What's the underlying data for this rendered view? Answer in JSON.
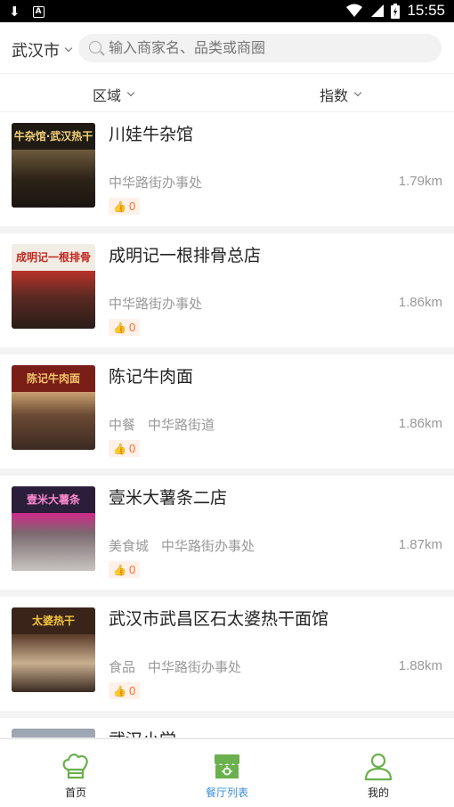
{
  "status_bar": {
    "time": "15:55",
    "icons": [
      "download-icon",
      "notification-a-icon",
      "wifi-icon",
      "signal-icon",
      "battery-charging-icon"
    ]
  },
  "header": {
    "city": "武汉市",
    "search_placeholder": "输入商家名、品类或商圈"
  },
  "filters": {
    "region": "区域",
    "index": "指数"
  },
  "restaurants": [
    {
      "name": "川娃牛杂馆",
      "tags": [
        "中华路街办事处"
      ],
      "distance": "1.79km",
      "likes": "0",
      "sign": "牛杂馆·武汉热干"
    },
    {
      "name": "成明记一根排骨总店",
      "tags": [
        "中华路街办事处"
      ],
      "distance": "1.86km",
      "likes": "0",
      "sign": "成明记一根排骨"
    },
    {
      "name": "陈记牛肉面",
      "tags": [
        "中餐",
        "中华路街道"
      ],
      "distance": "1.86km",
      "likes": "0",
      "sign": "陈记牛肉面"
    },
    {
      "name": "壹米大薯条二店",
      "tags": [
        "美食城",
        "中华路街办事处"
      ],
      "distance": "1.87km",
      "likes": "0",
      "sign": "壹米大薯条"
    },
    {
      "name": "武汉市武昌区石太婆热干面馆",
      "tags": [
        "食品",
        "中华路街办事处"
      ],
      "distance": "1.88km",
      "likes": "0",
      "sign": "太婆热干"
    },
    {
      "name": "武汉小学",
      "tags": [],
      "distance": "",
      "likes": "",
      "sign": ""
    }
  ],
  "bottom_nav": [
    {
      "label": "首页",
      "icon": "chef-hat-icon",
      "active": false
    },
    {
      "label": "餐厅列表",
      "icon": "storefront-icon",
      "active": true
    },
    {
      "label": "我的",
      "icon": "user-icon",
      "active": false
    }
  ],
  "colors": {
    "accent_green": "#6ab04c",
    "active_blue": "#3a8fd8",
    "like_orange": "#ff6a2b"
  }
}
